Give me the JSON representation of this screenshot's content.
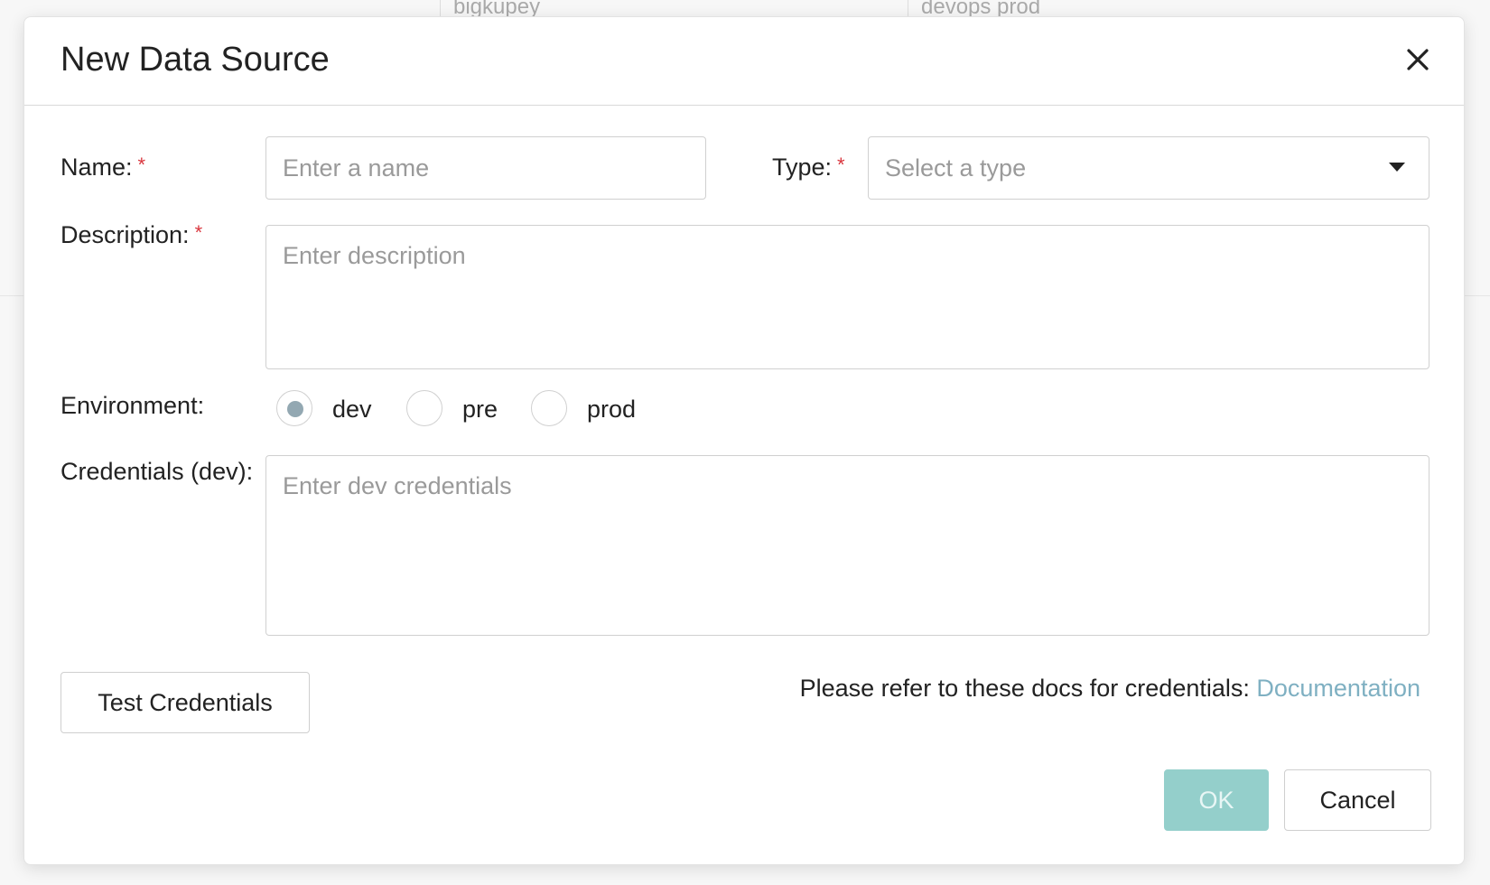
{
  "background": {
    "columns": [
      "bigkupey",
      "devops prod"
    ]
  },
  "modal": {
    "title": "New Data Source",
    "close_icon": "close-icon"
  },
  "form": {
    "name": {
      "label": "Name:",
      "required_mark": "*",
      "value": "",
      "placeholder": "Enter a name"
    },
    "type": {
      "label": "Type:",
      "required_mark": "*",
      "placeholder": "Select a type",
      "icon": "caret-down-icon"
    },
    "description": {
      "label": "Description:",
      "required_mark": "*",
      "value": "",
      "placeholder": "Enter description"
    },
    "environment": {
      "label": "Environment:",
      "options": [
        "dev",
        "pre",
        "prod"
      ],
      "selected": "dev"
    },
    "credentials": {
      "label": "Credentials (dev):",
      "value": "",
      "placeholder": "Enter dev credentials"
    }
  },
  "actions": {
    "test_credentials_label": "Test Credentials",
    "docs_text": "Please refer to these docs for credentials:",
    "docs_link_label": "Documentation",
    "ok_label": "OK",
    "cancel_label": "Cancel"
  },
  "colors": {
    "required": "#d9363e",
    "link": "#7fb0c2",
    "ok_button": "#94cfcb",
    "radio_selected": "#93a8b2"
  }
}
